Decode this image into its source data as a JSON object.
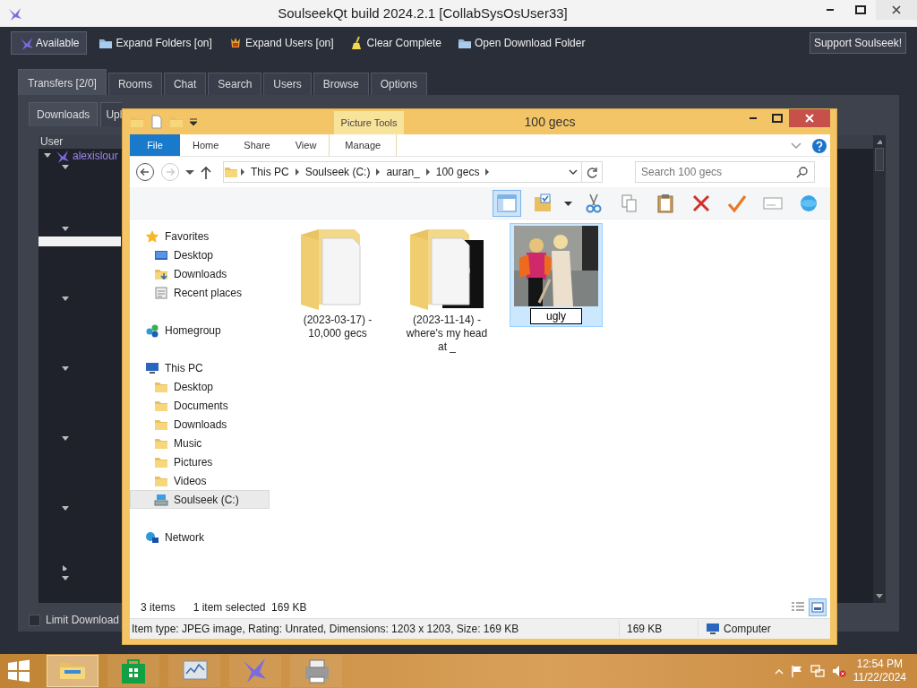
{
  "soulseek": {
    "title": "SoulseekQt build 2024.2.1 [CollabSysOsUser33]",
    "toolbar": [
      {
        "label": "Available",
        "kind": "status"
      },
      {
        "label": "Expand Folders [on]",
        "kind": "folder"
      },
      {
        "label": "Expand Users [on]",
        "kind": "users"
      },
      {
        "label": "Clear Complete",
        "kind": "broom"
      },
      {
        "label": "Open Download Folder",
        "kind": "folder"
      }
    ],
    "support_button": "Support Soulseek!",
    "tabs": [
      {
        "label": "Transfers [2/0]",
        "selected": true
      },
      {
        "label": "Rooms",
        "selected": false
      },
      {
        "label": "Chat",
        "selected": false
      },
      {
        "label": "Search",
        "selected": false
      },
      {
        "label": "Users",
        "selected": false
      },
      {
        "label": "Browse",
        "selected": false
      },
      {
        "label": "Options",
        "selected": false
      }
    ],
    "subtabs": [
      {
        "label": "Downloads",
        "selected": true
      },
      {
        "label": "Upl",
        "selected": false
      }
    ],
    "column": "User",
    "tree": [
      {
        "label": "alexislour",
        "expanded": true
      }
    ],
    "limit_download": {
      "label": "Limit Download",
      "checked": false
    }
  },
  "explorer": {
    "title": "100 gecs",
    "context_tab": "Picture Tools",
    "ribbon_tabs": [
      {
        "label": "File",
        "kind": "file"
      },
      {
        "label": "Home",
        "kind": "tab"
      },
      {
        "label": "Share",
        "kind": "tab"
      },
      {
        "label": "View",
        "kind": "tab"
      },
      {
        "label": "Manage",
        "kind": "context"
      }
    ],
    "breadcrumb": [
      "This PC",
      "Soulseek (C:)",
      "auran_",
      "100 gecs"
    ],
    "search": {
      "placeholder": "Search 100 gecs"
    },
    "preview_pane": {
      "on": true
    },
    "commands": [
      {
        "kind": "folder-check"
      },
      {
        "kind": "cut"
      },
      {
        "kind": "copy"
      },
      {
        "kind": "paste"
      },
      {
        "kind": "delete"
      },
      {
        "kind": "check"
      },
      {
        "kind": "rename"
      },
      {
        "kind": "globe"
      }
    ],
    "nav": [
      {
        "label": "Favorites",
        "kind": "star",
        "selected": false,
        "children": [
          {
            "label": "Desktop",
            "kind": "desktop",
            "selected": false
          },
          {
            "label": "Downloads",
            "kind": "downloads",
            "selected": false
          },
          {
            "label": "Recent places",
            "kind": "recent",
            "selected": false
          }
        ]
      },
      {
        "label": "Homegroup",
        "kind": "homegroup",
        "selected": false
      },
      {
        "label": "This PC",
        "kind": "pc",
        "selected": false,
        "children": [
          {
            "label": "Desktop",
            "kind": "folder",
            "selected": false
          },
          {
            "label": "Documents",
            "kind": "folder",
            "selected": false
          },
          {
            "label": "Downloads",
            "kind": "folder",
            "selected": false
          },
          {
            "label": "Music",
            "kind": "folder",
            "selected": false
          },
          {
            "label": "Pictures",
            "kind": "folder",
            "selected": false
          },
          {
            "label": "Videos",
            "kind": "folder",
            "selected": false
          },
          {
            "label": "Soulseek (C:)",
            "kind": "drive",
            "selected": true
          }
        ]
      },
      {
        "label": "Network",
        "kind": "network",
        "selected": false
      }
    ],
    "items": [
      {
        "label": "(2023-03-17) - 10,000 gecs",
        "kind": "folder",
        "selected": false
      },
      {
        "label": "(2023-11-14) - where's my head at _",
        "kind": "album-folder",
        "selected": false
      },
      {
        "label": "ugly",
        "kind": "picture",
        "selected": true,
        "renaming": true
      }
    ],
    "status": {
      "count": "3 items",
      "selection": "1 item selected  169 KB"
    },
    "details": {
      "info": "Item type: JPEG image, Rating: Unrated, Dimensions: 1203 x 1203, Size: 169 KB",
      "size": "169 KB",
      "location": "Computer"
    }
  },
  "taskbar": {
    "apps": [
      {
        "kind": "explorer",
        "selected": true
      },
      {
        "kind": "store",
        "selected": false
      },
      {
        "kind": "monitor",
        "selected": false
      },
      {
        "kind": "bird",
        "selected": false
      },
      {
        "kind": "printer",
        "selected": false
      }
    ],
    "time": "12:54 PM",
    "date": "11/22/2024"
  }
}
